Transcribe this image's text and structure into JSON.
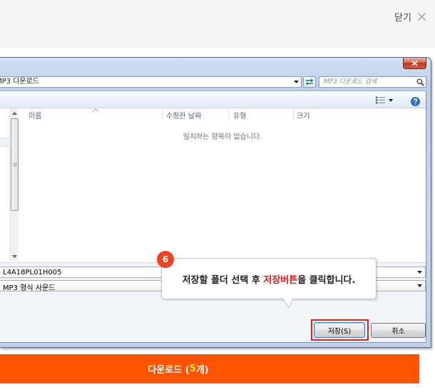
{
  "header": {
    "close_label": "닫기"
  },
  "dialog": {
    "address_path": "MP3 다운로드",
    "search_placeholder": "MP3 다운로드 검색",
    "columns": {
      "name": "이름",
      "modified": "수정한 날짜",
      "type": "유형",
      "size": "크기"
    },
    "empty_message": "일치하는 항목이 없습니다.",
    "file_name": "L4A18PL01H005",
    "file_type": "MP3 형식 사운드",
    "save_label": "저장(S)",
    "cancel_label": "취소"
  },
  "callout": {
    "step": "6",
    "text_before": "저장할 폴더 선택 후 ",
    "text_highlight": "저장버튼",
    "text_after": "을 클릭합니다."
  },
  "download": {
    "label_before": "다운로드 (",
    "count": "5",
    "label_after": "개)"
  },
  "icons": [
    "close-icon",
    "dialog-close-icon",
    "address-dropdown-arrow-icon",
    "refresh-icon",
    "search-icon",
    "views-icon",
    "views-dropdown-arrow-icon",
    "help-icon",
    "scroll-up-icon",
    "scroll-down-icon",
    "sort-up-icon",
    "file-name-dropdown-arrow-icon",
    "file-type-dropdown-arrow-icon"
  ],
  "colors": {
    "topbar_bg": "#f3f4f6",
    "download_bg": "#ff5300",
    "download_count": "#fff200",
    "callout_highlight": "#e8151b",
    "step_badge": "#ef4423",
    "save_highlight_box": "#e0231d",
    "dialog_close": "#c94a33"
  }
}
